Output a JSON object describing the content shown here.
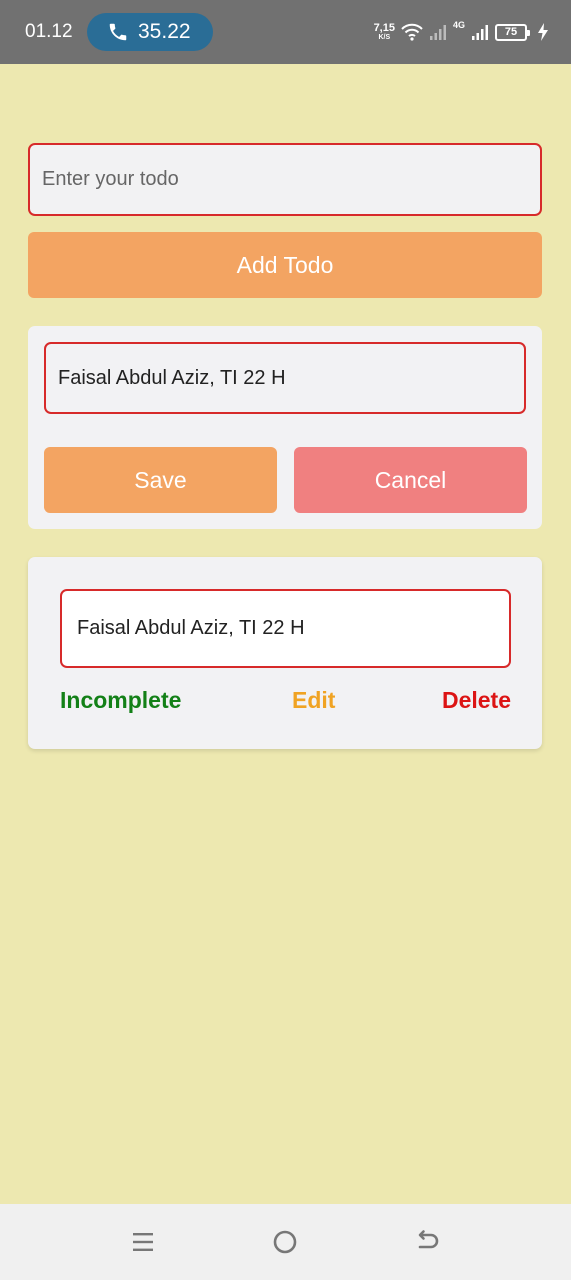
{
  "status_bar": {
    "time": "01.12",
    "call_duration": "35.22",
    "net_speed_value": "7,15",
    "net_speed_unit": "K/S",
    "network_type": "4G",
    "battery_level": "75",
    "icons": [
      "phone-icon",
      "wifi-icon",
      "signal-icon",
      "signal-icon",
      "battery-icon",
      "charging-icon"
    ]
  },
  "todo_form": {
    "input_placeholder": "Enter your todo",
    "input_value": "",
    "add_button_label": "Add Todo"
  },
  "edit_form": {
    "input_value": "Faisal Abdul Aziz, TI 22 H",
    "save_label": "Save",
    "cancel_label": "Cancel"
  },
  "todos": [
    {
      "text": "Faisal Abdul Aziz, TI 22 H",
      "status_action": "Incomplete",
      "edit_action": "Edit",
      "delete_action": "Delete"
    }
  ],
  "nav_bar": {
    "icons": [
      "recent-apps-icon",
      "home-icon",
      "back-icon"
    ]
  },
  "colors": {
    "background": "#ede8b0",
    "primary_button": "#f3a462",
    "cancel_button": "#f08080",
    "input_border": "#d72a2a",
    "incomplete": "#138017",
    "edit": "#f0a323",
    "delete": "#dc1414"
  }
}
